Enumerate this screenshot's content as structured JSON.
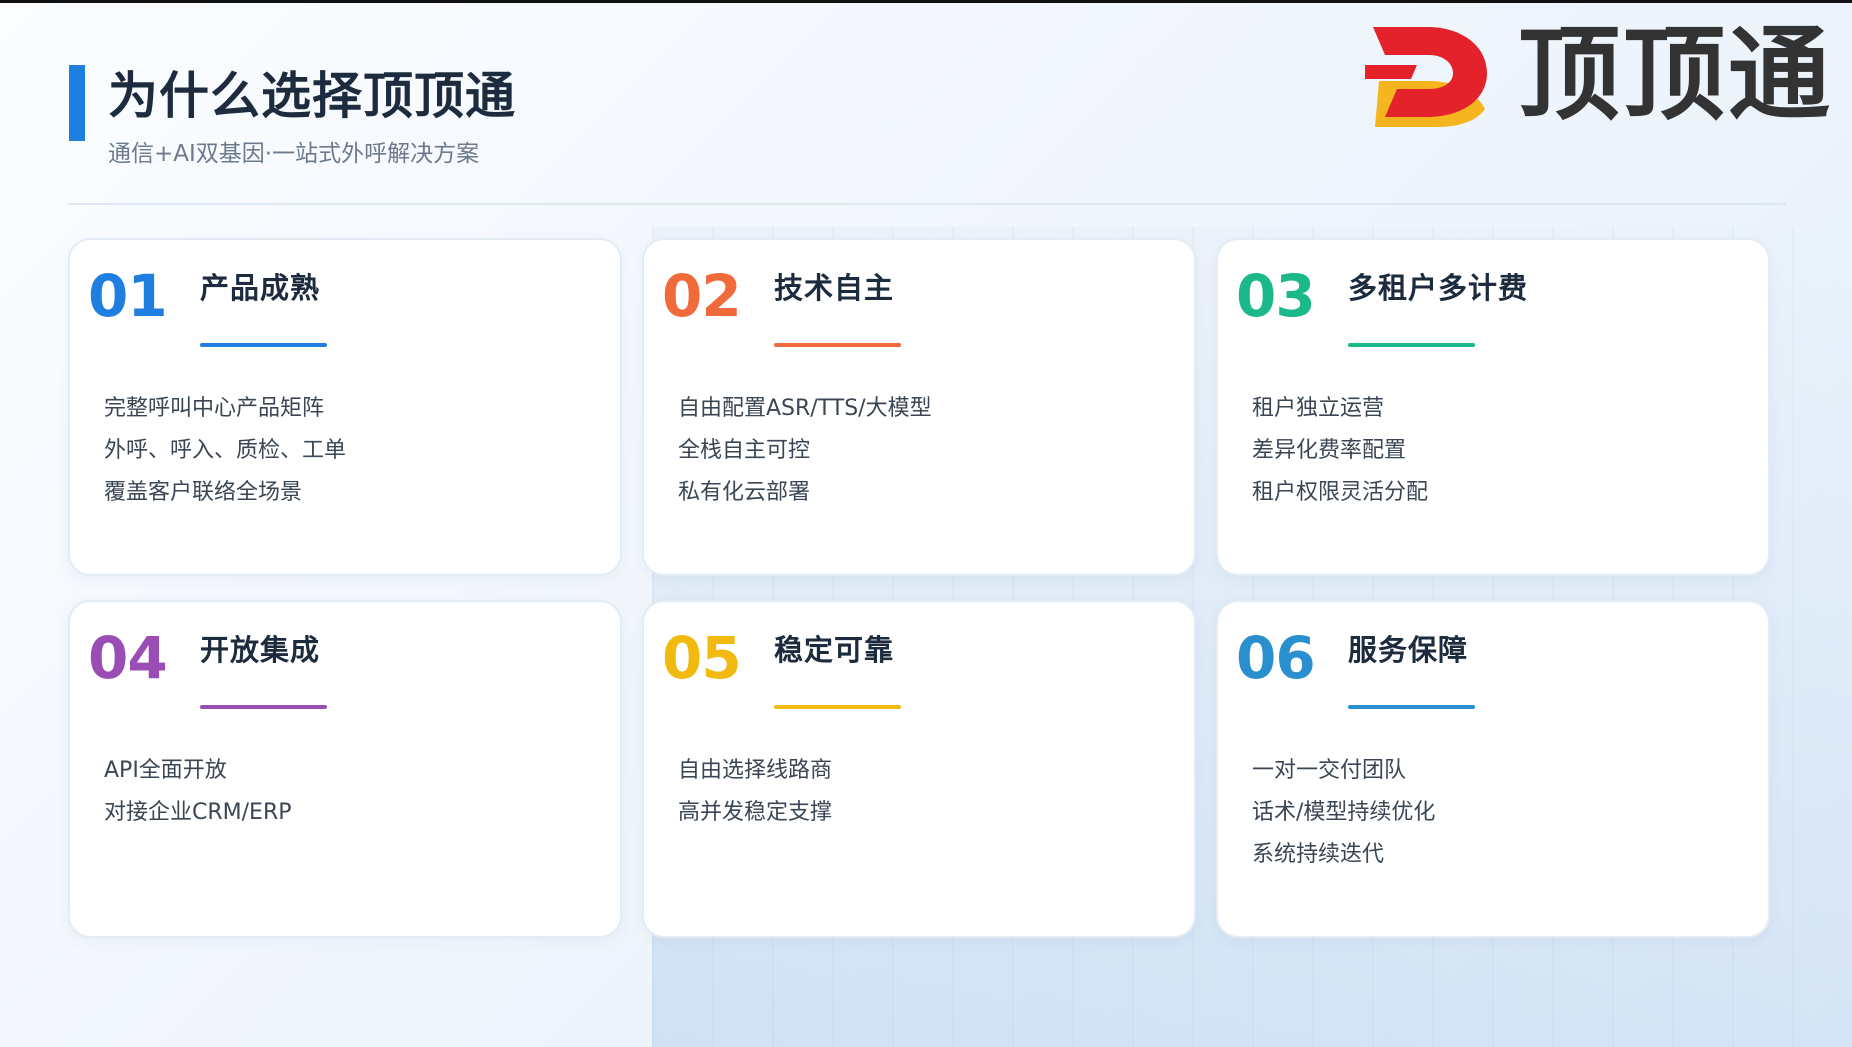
{
  "header": {
    "title": "为什么选择顶顶通",
    "subtitle": "通信+AI双基因·一站式外呼解决方案"
  },
  "logo": {
    "text": "顶顶通",
    "mark_icon": "dingdingtong-logo-icon",
    "mark_colors": {
      "red": "#e3222b",
      "yellow": "#f5b51e"
    }
  },
  "colors": {
    "accent": "#1f7fe0",
    "card1": "#1f7fe0",
    "card2": "#f06a3c",
    "card3": "#1bb88a",
    "card4": "#9a4eb5",
    "card5": "#f2b90f",
    "card6": "#2a8fcf"
  },
  "cards": [
    {
      "number": "01",
      "title": "产品成熟",
      "lines": [
        "完整呼叫中心产品矩阵",
        "外呼、呼入、质检、工单",
        "覆盖客户联络全场景"
      ]
    },
    {
      "number": "02",
      "title": "技术自主",
      "lines": [
        "自由配置ASR/TTS/大模型",
        "全栈自主可控",
        "私有化云部署"
      ]
    },
    {
      "number": "03",
      "title": "多租户多计费",
      "lines": [
        "租户独立运营",
        "差异化费率配置",
        "租户权限灵活分配"
      ]
    },
    {
      "number": "04",
      "title": "开放集成",
      "lines": [
        "API全面开放",
        "对接企业CRM/ERP"
      ]
    },
    {
      "number": "05",
      "title": "稳定可靠",
      "lines": [
        "自由选择线路商",
        "高并发稳定支撑"
      ]
    },
    {
      "number": "06",
      "title": "服务保障",
      "lines": [
        "一对一交付团队",
        "话术/模型持续优化",
        "系统持续迭代"
      ]
    }
  ]
}
